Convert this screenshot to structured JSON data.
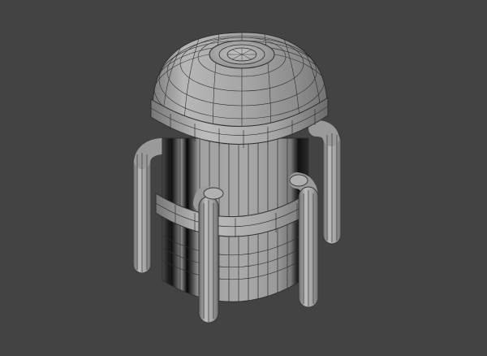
{
  "viewport": {
    "background_color": "#434343",
    "object": "tank",
    "wireframe_color": "#2f2f2f",
    "shaded_color": "#a9a9a9",
    "reflection_dark_color": "#000000"
  }
}
